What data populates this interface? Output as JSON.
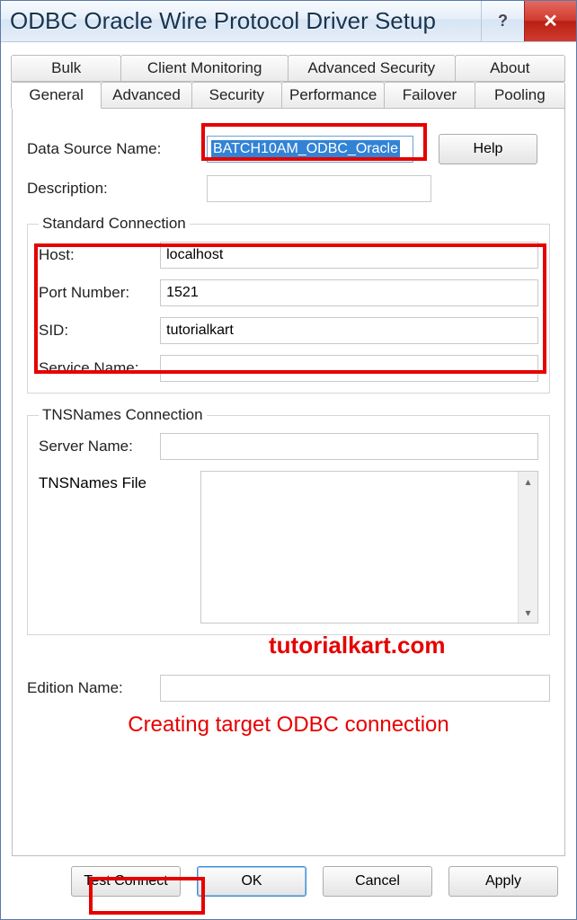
{
  "window": {
    "title": "ODBC Oracle Wire Protocol Driver Setup"
  },
  "tabs_row1": [
    {
      "label": "Bulk"
    },
    {
      "label": "Client Monitoring"
    },
    {
      "label": "Advanced Security"
    },
    {
      "label": "About"
    }
  ],
  "tabs_row2": [
    {
      "label": "General"
    },
    {
      "label": "Advanced"
    },
    {
      "label": "Security"
    },
    {
      "label": "Performance"
    },
    {
      "label": "Failover"
    },
    {
      "label": "Pooling"
    }
  ],
  "general": {
    "dsn_label": "Data Source Name:",
    "dsn_value": "BATCH10AM_ODBC_Oracle",
    "help_label": "Help",
    "desc_label": "Description:",
    "desc_value": "",
    "std_legend": "Standard Connection",
    "host_label": "Host:",
    "host_value": "localhost",
    "port_label": "Port Number:",
    "port_value": "1521",
    "sid_label": "SID:",
    "sid_value": "tutorialkart",
    "service_label": "Service Name:",
    "service_value": "",
    "tns_legend": "TNSNames Connection",
    "server_label": "Server Name:",
    "server_value": "",
    "tnsfile_label": "TNSNames File",
    "tnsfile_value": "",
    "edition_label": "Edition Name:",
    "edition_value": ""
  },
  "annotations": {
    "watermark": "tutorialkart.com",
    "subtitle": "Creating target ODBC connection"
  },
  "footer": {
    "test": "Test Connect",
    "ok": "OK",
    "cancel": "Cancel",
    "apply": "Apply"
  }
}
